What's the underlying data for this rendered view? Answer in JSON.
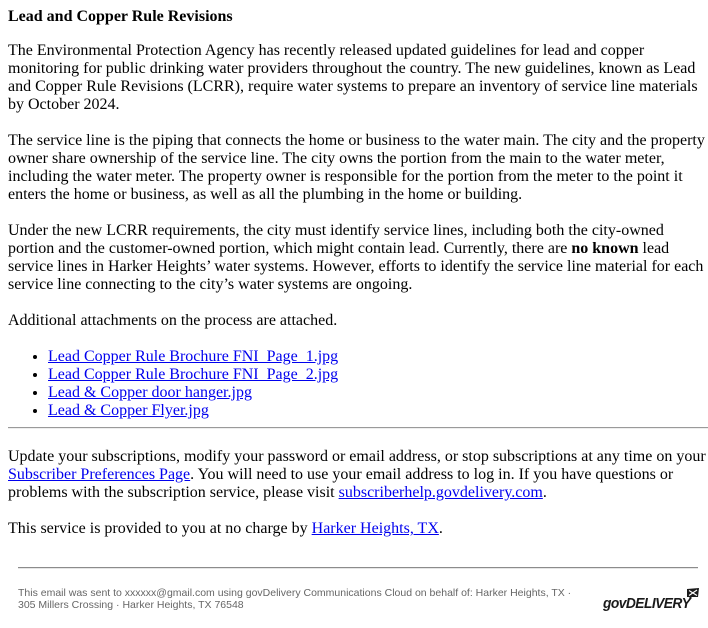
{
  "article": {
    "title": "Lead and Copper Rule Revisions",
    "paragraph1": "The Environmental Protection Agency has recently released updated guidelines for lead and copper monitoring for public drinking water providers throughout the country. The new guidelines, known as Lead and Copper Rule Revisions (LCRR), require water systems to prepare an inventory of service line materials by October 2024.",
    "paragraph2": "The service line is the piping that connects the home or business to the water main. The city and the property owner share ownership of the service line. The city owns the portion from the main to the water meter, including the water meter. The property owner is responsible for the portion from the meter to the point it enters the home or business, as well as all the plumbing in the home or building.",
    "paragraph3_before": "Under the new LCRR requirements, the city must identify service lines, including both the city-owned portion and the customer-owned portion, which might contain lead. Currently, there are ",
    "paragraph3_bold": "no known",
    "paragraph3_after": " lead service lines in Harker Heights’ water systems. However, efforts to identify the service line material for each service line connecting to the city’s water systems are ongoing.",
    "attachments_intro": "Additional attachments on the process are attached.",
    "attachments": [
      {
        "label": "Lead Copper Rule Brochure FNI_Page_1.jpg"
      },
      {
        "label": "Lead Copper Rule Brochure FNI_Page_2.jpg"
      },
      {
        "label": "Lead & Copper door hanger.jpg"
      },
      {
        "label": "Lead & Copper Flyer.jpg"
      }
    ]
  },
  "subscription": {
    "text1": "Update your subscriptions, modify your password or email address, or stop subscriptions at any time on your ",
    "preferences_link": "Subscriber Preferences Page",
    "text2": ". You will need to use your email address to log in. If you have questions or problems with the subscription service, please visit ",
    "help_link": "subscriberhelp.govdelivery.com",
    "text3": ".",
    "service_text": "This service is provided to you at no charge by ",
    "service_link": "Harker Heights, TX",
    "service_end": "."
  },
  "footer": {
    "text": "This email was sent to xxxxxx@gmail.com using govDelivery Communications Cloud on behalf of: Harker Heights, TX · 305 Millers Crossing · Harker Heights, TX 76548",
    "logo_text": "GOVDELIVERY",
    "logo_icon": "envelope-icon"
  },
  "colors": {
    "link": "#0000ee",
    "footer_text": "#666666",
    "rule": "#9a9a9a"
  }
}
